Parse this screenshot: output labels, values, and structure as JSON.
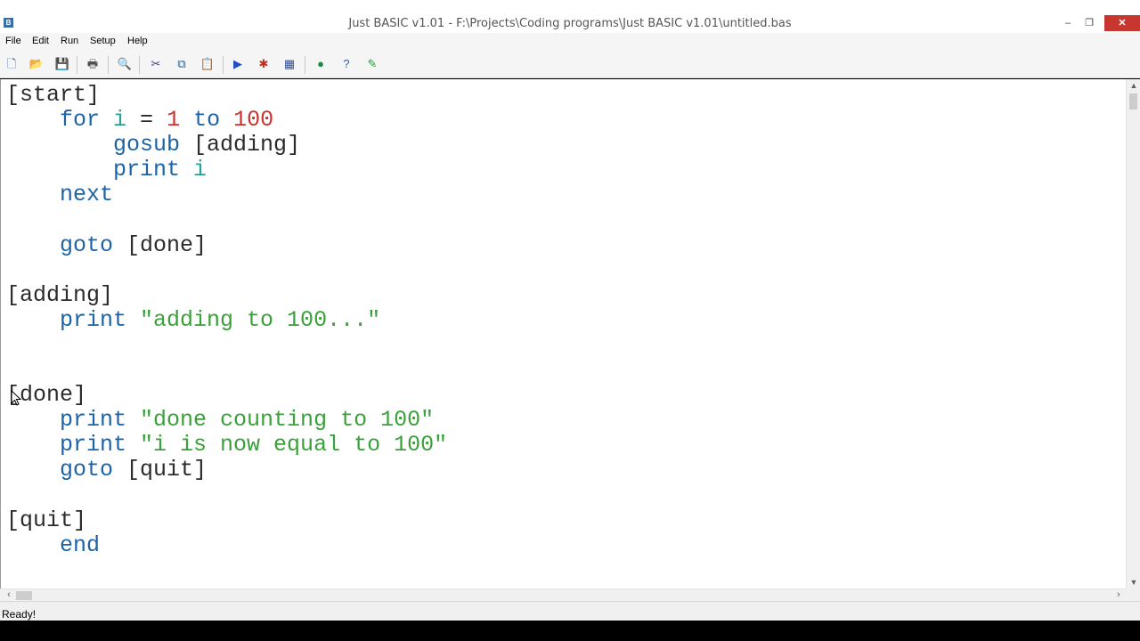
{
  "window": {
    "title": "Just BASIC v1.01 - F:\\Projects\\Coding programs\\Just BASIC v1.01\\untitled.bas",
    "app_icon_glyph": "B",
    "minimize_glyph": "–",
    "maximize_glyph": "❐",
    "close_glyph": "✕"
  },
  "menu": {
    "items": [
      "File",
      "Edit",
      "Run",
      "Setup",
      "Help"
    ]
  },
  "toolbar": {
    "buttons": [
      {
        "icon": "new-file-icon",
        "glyph": "🗋",
        "color": "#3060c0"
      },
      {
        "icon": "open-folder-icon",
        "glyph": "📂",
        "color": "#e0a020"
      },
      {
        "icon": "save-icon",
        "glyph": "💾",
        "color": "#2050a0"
      },
      {
        "icon": "print-icon",
        "glyph": "🖶",
        "color": "#505050"
      },
      {
        "icon": "find-icon",
        "glyph": "🔍",
        "color": "#a06020"
      },
      {
        "icon": "cut-icon",
        "glyph": "✂",
        "color": "#404080"
      },
      {
        "icon": "copy-icon",
        "glyph": "⧉",
        "color": "#2060a0"
      },
      {
        "icon": "paste-icon",
        "glyph": "📋",
        "color": "#806020"
      },
      {
        "icon": "run-icon",
        "glyph": "▶",
        "color": "#2050c0"
      },
      {
        "icon": "debug-icon",
        "glyph": "✱",
        "color": "#c03020"
      },
      {
        "icon": "gui-editor-icon",
        "glyph": "▦",
        "color": "#3050a0"
      },
      {
        "icon": "web-icon",
        "glyph": "●",
        "color": "#1c8a4a"
      },
      {
        "icon": "help-icon",
        "glyph": "?",
        "color": "#2060c0"
      },
      {
        "icon": "notes-icon",
        "glyph": "✎",
        "color": "#2a9a3a"
      }
    ]
  },
  "editor": {
    "lines": [
      [
        {
          "t": "[start]",
          "c": "lbl"
        }
      ],
      [
        {
          "t": "    for ",
          "c": "kw"
        },
        {
          "t": "i",
          "c": "var"
        },
        {
          "t": " = ",
          "c": "lbl"
        },
        {
          "t": "1",
          "c": "num"
        },
        {
          "t": " to ",
          "c": "kw"
        },
        {
          "t": "100",
          "c": "num"
        }
      ],
      [
        {
          "t": "        gosub ",
          "c": "kw"
        },
        {
          "t": "[adding]",
          "c": "lbl"
        }
      ],
      [
        {
          "t": "        print ",
          "c": "kw"
        },
        {
          "t": "i",
          "c": "var"
        }
      ],
      [
        {
          "t": "    next",
          "c": "kw"
        }
      ],
      [],
      [
        {
          "t": "    goto ",
          "c": "kw"
        },
        {
          "t": "[done]",
          "c": "lbl"
        }
      ],
      [],
      [
        {
          "t": "[adding]",
          "c": "lbl"
        }
      ],
      [
        {
          "t": "    print ",
          "c": "kw"
        },
        {
          "t": "\"adding to 100...\"",
          "c": "str"
        }
      ],
      [],
      [],
      [
        {
          "t": "[done]",
          "c": "lbl"
        }
      ],
      [
        {
          "t": "    print ",
          "c": "kw"
        },
        {
          "t": "\"done counting to 100\"",
          "c": "str"
        }
      ],
      [
        {
          "t": "    print ",
          "c": "kw"
        },
        {
          "t": "\"i is now equal to 100\"",
          "c": "str"
        }
      ],
      [
        {
          "t": "    goto ",
          "c": "kw"
        },
        {
          "t": "[quit]",
          "c": "lbl"
        }
      ],
      [],
      [
        {
          "t": "[quit]",
          "c": "lbl"
        }
      ],
      [
        {
          "t": "    end",
          "c": "kw"
        }
      ]
    ]
  },
  "scrollbars": {
    "up_glyph": "▲",
    "down_glyph": "▼",
    "left_glyph": "‹",
    "right_glyph": "›"
  },
  "status": {
    "text": "Ready!"
  }
}
